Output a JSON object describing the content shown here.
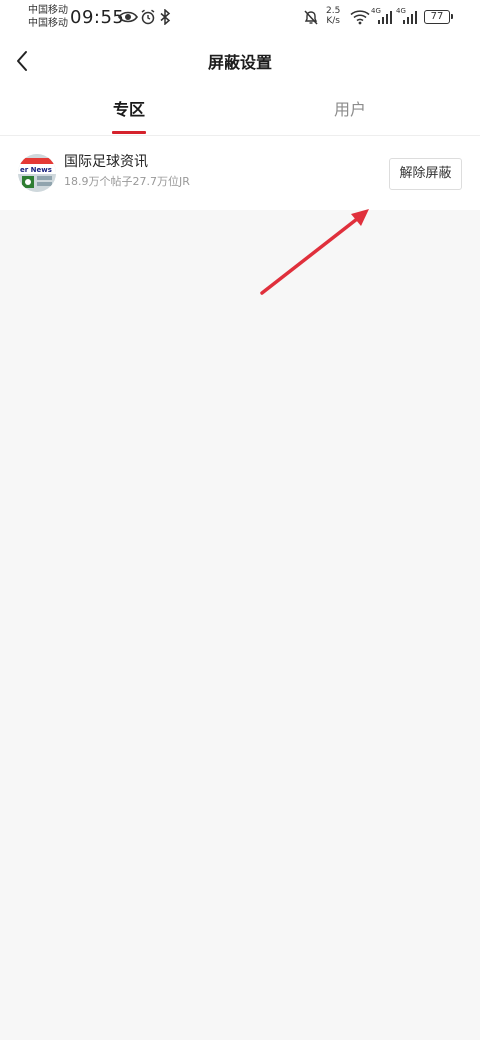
{
  "status_bar": {
    "carrier1": "中国移动",
    "carrier2": "中国移动",
    "time": "09:55",
    "net_speed_value": "2.5",
    "net_speed_unit": "K/s",
    "signal1_label": "4G",
    "signal2_label": "4G",
    "battery": "77"
  },
  "nav": {
    "title": "屏蔽设置"
  },
  "tabs": {
    "items": [
      {
        "label": "专区"
      },
      {
        "label": "用户"
      }
    ]
  },
  "list": {
    "items": [
      {
        "title": "国际足球资讯",
        "subtitle": "18.9万个帖子27.7万位JR",
        "button_label": "解除屏蔽",
        "avatar_text": "er News"
      }
    ]
  },
  "colors": {
    "accent": "#d5222c",
    "annotation": "#e0303c"
  }
}
